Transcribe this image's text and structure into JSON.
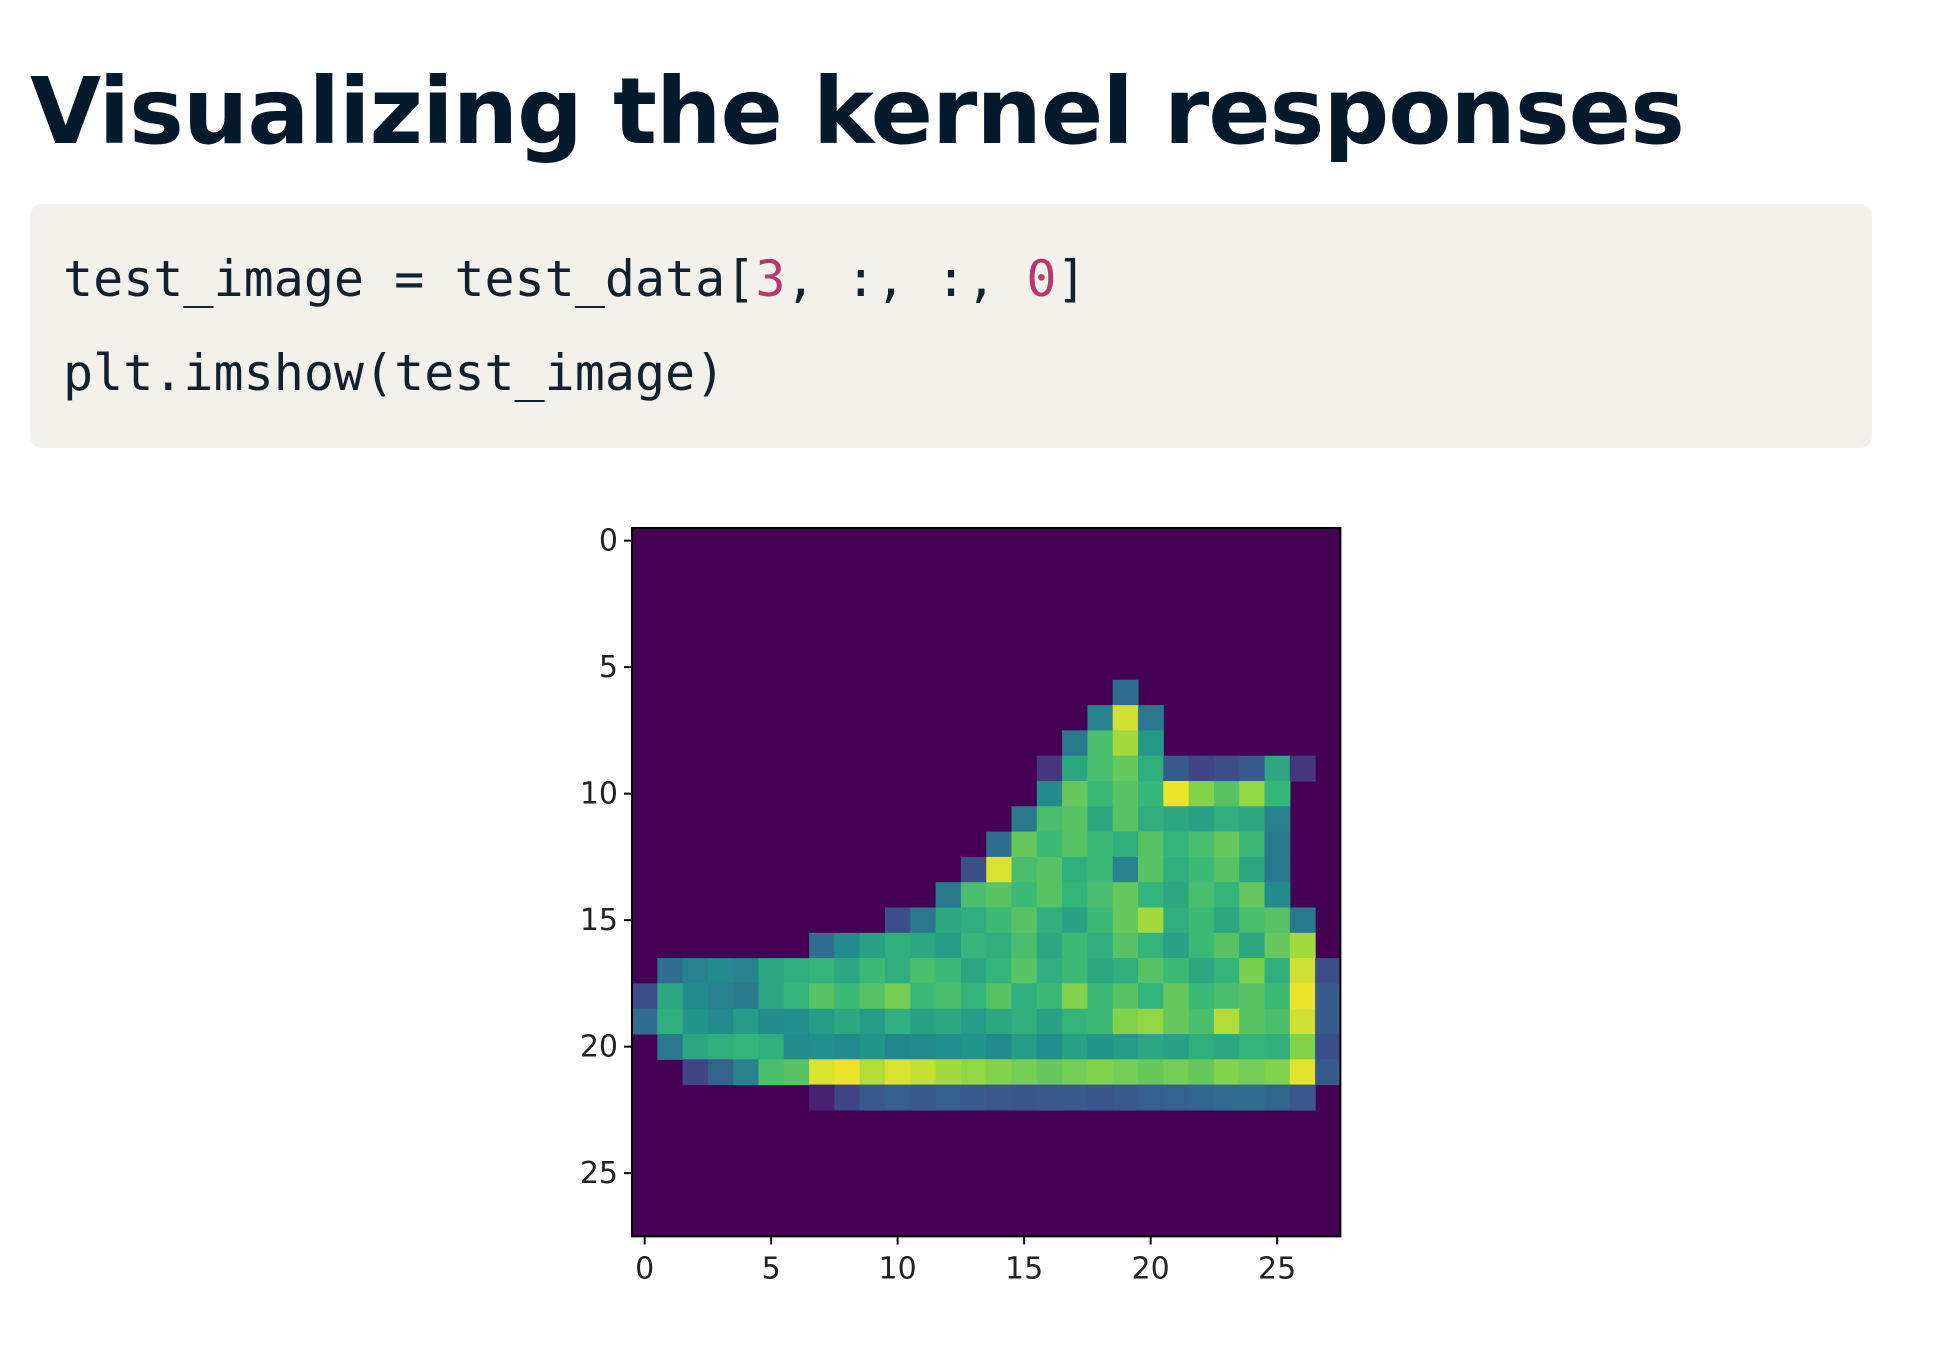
{
  "slide": {
    "title": "Visualizing the kernel responses"
  },
  "code": {
    "line1": {
      "var": "test_image",
      "op": " = ",
      "call": "test_data[",
      "idx": "3",
      "mid": ", :, :, ",
      "channel": "0",
      "close": "]"
    },
    "line2": "plt.imshow(test_image)"
  },
  "colors": {
    "number_literal": "#b7386f",
    "code_background": "#f4f1ec",
    "title": "#05192d",
    "colormap": "viridis"
  },
  "chart_data": {
    "type": "heatmap",
    "title": "",
    "xlabel": "",
    "ylabel": "",
    "colormap": "viridis",
    "xticks": [
      0,
      5,
      10,
      15,
      20,
      25
    ],
    "yticks": [
      0,
      5,
      10,
      15,
      20,
      25
    ],
    "xlim": [
      -0.5,
      27.5
    ],
    "ylim": [
      27.5,
      -0.5
    ],
    "grid": false,
    "legend": "none",
    "row_ranges_description_unused": null,
    "rows": [
      [],
      [],
      [],
      [],
      [],
      [],
      [
        [
          19,
          19,
          0.45
        ]
      ],
      [
        [
          18,
          18,
          0.55
        ],
        [
          19,
          19,
          0.95
        ],
        [
          20,
          20,
          0.5
        ]
      ],
      [
        [
          17,
          17,
          0.5
        ],
        [
          18,
          18,
          0.78
        ],
        [
          19,
          19,
          0.9
        ],
        [
          20,
          20,
          0.65
        ]
      ],
      [
        [
          16,
          16,
          0.2
        ],
        [
          17,
          17,
          0.7
        ],
        [
          18,
          18,
          0.78
        ],
        [
          19,
          19,
          0.82
        ],
        [
          20,
          20,
          0.72
        ],
        [
          21,
          21,
          0.35
        ],
        [
          22,
          22,
          0.25
        ],
        [
          23,
          23,
          0.3
        ],
        [
          24,
          24,
          0.35
        ],
        [
          25,
          25,
          0.7
        ],
        [
          26,
          26,
          0.2
        ]
      ],
      [
        [
          16,
          16,
          0.6
        ],
        [
          17,
          17,
          0.82
        ],
        [
          18,
          18,
          0.76
        ],
        [
          19,
          19,
          0.8
        ],
        [
          20,
          20,
          0.75
        ],
        [
          21,
          21,
          0.98
        ],
        [
          22,
          22,
          0.86
        ],
        [
          23,
          23,
          0.8
        ],
        [
          24,
          24,
          0.88
        ],
        [
          25,
          25,
          0.75
        ]
      ],
      [
        [
          15,
          15,
          0.5
        ],
        [
          16,
          16,
          0.78
        ],
        [
          17,
          17,
          0.8
        ],
        [
          18,
          18,
          0.7
        ],
        [
          19,
          19,
          0.8
        ],
        [
          20,
          20,
          0.72
        ],
        [
          21,
          21,
          0.7
        ],
        [
          22,
          22,
          0.68
        ],
        [
          23,
          23,
          0.72
        ],
        [
          24,
          24,
          0.7
        ],
        [
          25,
          25,
          0.55
        ]
      ],
      [
        [
          14,
          14,
          0.45
        ],
        [
          15,
          15,
          0.82
        ],
        [
          16,
          16,
          0.76
        ],
        [
          17,
          17,
          0.8
        ],
        [
          18,
          18,
          0.76
        ],
        [
          19,
          19,
          0.72
        ],
        [
          20,
          20,
          0.8
        ],
        [
          21,
          21,
          0.74
        ],
        [
          22,
          22,
          0.78
        ],
        [
          23,
          23,
          0.82
        ],
        [
          24,
          24,
          0.76
        ],
        [
          25,
          25,
          0.5
        ]
      ],
      [
        [
          13,
          13,
          0.3
        ],
        [
          14,
          14,
          0.96
        ],
        [
          15,
          15,
          0.78
        ],
        [
          16,
          16,
          0.8
        ],
        [
          17,
          17,
          0.72
        ],
        [
          18,
          18,
          0.76
        ],
        [
          19,
          19,
          0.55
        ],
        [
          20,
          20,
          0.8
        ],
        [
          21,
          21,
          0.72
        ],
        [
          22,
          22,
          0.76
        ],
        [
          23,
          23,
          0.8
        ],
        [
          24,
          24,
          0.7
        ],
        [
          25,
          25,
          0.5
        ]
      ],
      [
        [
          12,
          12,
          0.5
        ],
        [
          13,
          13,
          0.78
        ],
        [
          14,
          14,
          0.8
        ],
        [
          15,
          15,
          0.76
        ],
        [
          16,
          16,
          0.8
        ],
        [
          17,
          17,
          0.74
        ],
        [
          18,
          18,
          0.78
        ],
        [
          19,
          19,
          0.82
        ],
        [
          20,
          20,
          0.74
        ],
        [
          21,
          21,
          0.7
        ],
        [
          22,
          22,
          0.78
        ],
        [
          23,
          23,
          0.74
        ],
        [
          24,
          24,
          0.82
        ],
        [
          25,
          25,
          0.6
        ]
      ],
      [
        [
          10,
          10,
          0.3
        ],
        [
          11,
          11,
          0.5
        ],
        [
          12,
          12,
          0.7
        ],
        [
          13,
          13,
          0.72
        ],
        [
          14,
          14,
          0.76
        ],
        [
          15,
          15,
          0.8
        ],
        [
          16,
          16,
          0.72
        ],
        [
          17,
          17,
          0.68
        ],
        [
          18,
          18,
          0.76
        ],
        [
          19,
          19,
          0.82
        ],
        [
          20,
          20,
          0.9
        ],
        [
          21,
          21,
          0.72
        ],
        [
          22,
          22,
          0.76
        ],
        [
          23,
          23,
          0.7
        ],
        [
          24,
          24,
          0.78
        ],
        [
          25,
          25,
          0.8
        ],
        [
          26,
          26,
          0.5
        ]
      ],
      [
        [
          7,
          7,
          0.45
        ],
        [
          8,
          8,
          0.6
        ],
        [
          9,
          9,
          0.68
        ],
        [
          10,
          10,
          0.72
        ],
        [
          11,
          11,
          0.7
        ],
        [
          12,
          12,
          0.66
        ],
        [
          13,
          13,
          0.74
        ],
        [
          14,
          14,
          0.72
        ],
        [
          15,
          15,
          0.78
        ],
        [
          16,
          16,
          0.7
        ],
        [
          17,
          17,
          0.76
        ],
        [
          18,
          18,
          0.72
        ],
        [
          19,
          19,
          0.8
        ],
        [
          20,
          20,
          0.74
        ],
        [
          21,
          21,
          0.68
        ],
        [
          22,
          22,
          0.76
        ],
        [
          23,
          23,
          0.8
        ],
        [
          24,
          24,
          0.7
        ],
        [
          25,
          25,
          0.82
        ],
        [
          26,
          26,
          0.9
        ]
      ],
      [
        [
          1,
          1,
          0.45
        ],
        [
          2,
          2,
          0.55
        ],
        [
          3,
          3,
          0.6
        ],
        [
          4,
          4,
          0.55
        ],
        [
          5,
          5,
          0.7
        ],
        [
          6,
          6,
          0.72
        ],
        [
          7,
          7,
          0.74
        ],
        [
          8,
          8,
          0.7
        ],
        [
          9,
          9,
          0.76
        ],
        [
          10,
          10,
          0.72
        ],
        [
          11,
          11,
          0.78
        ],
        [
          12,
          12,
          0.76
        ],
        [
          13,
          13,
          0.7
        ],
        [
          14,
          14,
          0.74
        ],
        [
          15,
          15,
          0.8
        ],
        [
          16,
          16,
          0.72
        ],
        [
          17,
          17,
          0.76
        ],
        [
          18,
          18,
          0.7
        ],
        [
          19,
          19,
          0.72
        ],
        [
          20,
          20,
          0.8
        ],
        [
          21,
          21,
          0.76
        ],
        [
          22,
          22,
          0.7
        ],
        [
          23,
          23,
          0.74
        ],
        [
          24,
          24,
          0.85
        ],
        [
          25,
          25,
          0.72
        ],
        [
          26,
          26,
          0.95
        ],
        [
          27,
          27,
          0.3
        ]
      ],
      [
        [
          0,
          0,
          0.3
        ],
        [
          1,
          1,
          0.7
        ],
        [
          2,
          2,
          0.6
        ],
        [
          3,
          3,
          0.55
        ],
        [
          4,
          4,
          0.5
        ],
        [
          5,
          5,
          0.7
        ],
        [
          6,
          6,
          0.74
        ],
        [
          7,
          7,
          0.8
        ],
        [
          8,
          8,
          0.76
        ],
        [
          9,
          9,
          0.8
        ],
        [
          10,
          10,
          0.84
        ],
        [
          11,
          11,
          0.76
        ],
        [
          12,
          12,
          0.78
        ],
        [
          13,
          13,
          0.74
        ],
        [
          14,
          14,
          0.8
        ],
        [
          15,
          15,
          0.72
        ],
        [
          16,
          16,
          0.76
        ],
        [
          17,
          17,
          0.86
        ],
        [
          18,
          18,
          0.76
        ],
        [
          19,
          19,
          0.8
        ],
        [
          20,
          20,
          0.74
        ],
        [
          21,
          21,
          0.82
        ],
        [
          22,
          22,
          0.76
        ],
        [
          23,
          23,
          0.78
        ],
        [
          24,
          24,
          0.8
        ],
        [
          25,
          25,
          0.76
        ],
        [
          26,
          26,
          0.98
        ],
        [
          27,
          27,
          0.35
        ]
      ],
      [
        [
          0,
          0,
          0.45
        ],
        [
          1,
          1,
          0.72
        ],
        [
          2,
          2,
          0.64
        ],
        [
          3,
          3,
          0.6
        ],
        [
          4,
          4,
          0.66
        ],
        [
          5,
          5,
          0.6
        ],
        [
          6,
          6,
          0.62
        ],
        [
          7,
          7,
          0.66
        ],
        [
          8,
          8,
          0.7
        ],
        [
          9,
          9,
          0.66
        ],
        [
          10,
          10,
          0.72
        ],
        [
          11,
          11,
          0.68
        ],
        [
          12,
          12,
          0.7
        ],
        [
          13,
          13,
          0.66
        ],
        [
          14,
          14,
          0.7
        ],
        [
          15,
          15,
          0.72
        ],
        [
          16,
          16,
          0.68
        ],
        [
          17,
          17,
          0.74
        ],
        [
          18,
          18,
          0.76
        ],
        [
          19,
          19,
          0.86
        ],
        [
          20,
          20,
          0.88
        ],
        [
          21,
          21,
          0.82
        ],
        [
          22,
          22,
          0.78
        ],
        [
          23,
          23,
          0.92
        ],
        [
          24,
          24,
          0.8
        ],
        [
          25,
          25,
          0.78
        ],
        [
          26,
          26,
          0.95
        ],
        [
          27,
          27,
          0.35
        ]
      ],
      [
        [
          1,
          1,
          0.5
        ],
        [
          2,
          2,
          0.7
        ],
        [
          3,
          3,
          0.72
        ],
        [
          4,
          4,
          0.74
        ],
        [
          5,
          5,
          0.72
        ],
        [
          6,
          6,
          0.6
        ],
        [
          7,
          7,
          0.62
        ],
        [
          8,
          8,
          0.6
        ],
        [
          9,
          9,
          0.64
        ],
        [
          10,
          10,
          0.58
        ],
        [
          11,
          11,
          0.6
        ],
        [
          12,
          12,
          0.62
        ],
        [
          13,
          13,
          0.64
        ],
        [
          14,
          14,
          0.6
        ],
        [
          15,
          15,
          0.66
        ],
        [
          16,
          16,
          0.62
        ],
        [
          17,
          17,
          0.68
        ],
        [
          18,
          18,
          0.64
        ],
        [
          19,
          19,
          0.66
        ],
        [
          20,
          20,
          0.7
        ],
        [
          21,
          21,
          0.68
        ],
        [
          22,
          22,
          0.72
        ],
        [
          23,
          23,
          0.7
        ],
        [
          24,
          24,
          0.74
        ],
        [
          25,
          25,
          0.72
        ],
        [
          26,
          26,
          0.86
        ],
        [
          27,
          27,
          0.3
        ]
      ],
      [
        [
          2,
          2,
          0.25
        ],
        [
          3,
          3,
          0.4
        ],
        [
          4,
          4,
          0.55
        ],
        [
          5,
          5,
          0.78
        ],
        [
          6,
          6,
          0.8
        ],
        [
          7,
          7,
          0.96
        ],
        [
          8,
          8,
          0.98
        ],
        [
          9,
          9,
          0.92
        ],
        [
          10,
          10,
          0.96
        ],
        [
          11,
          11,
          0.94
        ],
        [
          12,
          12,
          0.9
        ],
        [
          13,
          13,
          0.88
        ],
        [
          14,
          14,
          0.86
        ],
        [
          15,
          15,
          0.84
        ],
        [
          16,
          16,
          0.82
        ],
        [
          17,
          17,
          0.84
        ],
        [
          18,
          18,
          0.86
        ],
        [
          19,
          19,
          0.84
        ],
        [
          20,
          20,
          0.82
        ],
        [
          21,
          21,
          0.84
        ],
        [
          22,
          22,
          0.82
        ],
        [
          23,
          23,
          0.86
        ],
        [
          24,
          24,
          0.84
        ],
        [
          25,
          25,
          0.86
        ],
        [
          26,
          26,
          0.97
        ],
        [
          27,
          27,
          0.35
        ]
      ],
      [
        [
          7,
          7,
          0.12
        ],
        [
          8,
          8,
          0.25
        ],
        [
          9,
          9,
          0.35
        ],
        [
          10,
          10,
          0.38
        ],
        [
          11,
          11,
          0.35
        ],
        [
          12,
          12,
          0.38
        ],
        [
          13,
          13,
          0.36
        ],
        [
          14,
          14,
          0.34
        ],
        [
          15,
          15,
          0.33
        ],
        [
          16,
          16,
          0.35
        ],
        [
          17,
          17,
          0.36
        ],
        [
          18,
          18,
          0.33
        ],
        [
          19,
          19,
          0.35
        ],
        [
          20,
          20,
          0.38
        ],
        [
          21,
          21,
          0.4
        ],
        [
          22,
          22,
          0.42
        ],
        [
          23,
          23,
          0.44
        ],
        [
          24,
          24,
          0.45
        ],
        [
          25,
          25,
          0.42
        ],
        [
          26,
          26,
          0.35
        ]
      ],
      [],
      [],
      [],
      [],
      [],
      []
    ]
  }
}
